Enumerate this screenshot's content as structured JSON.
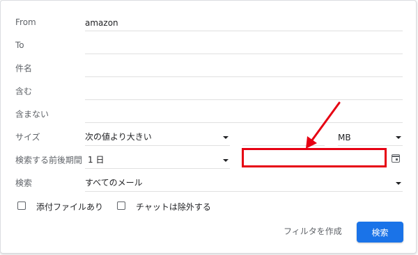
{
  "fields": {
    "from": {
      "label": "From",
      "value": "amazon"
    },
    "to": {
      "label": "To",
      "value": ""
    },
    "subject": {
      "label": "件名",
      "value": ""
    },
    "has_words": {
      "label": "含む",
      "value": ""
    },
    "doesnt_have": {
      "label": "含まない",
      "value": ""
    }
  },
  "size": {
    "label": "サイズ",
    "operator": "次の値より大きい",
    "unit": "MB"
  },
  "date_within": {
    "label": "検索する前後期間",
    "value": "1 日"
  },
  "search_in": {
    "label": "検索",
    "value": "すべてのメール"
  },
  "checkboxes": {
    "has_attachment": "添付ファイルあり",
    "exclude_chats": "チャットは除外する"
  },
  "actions": {
    "create_filter": "フィルタを作成",
    "search": "検索"
  },
  "colors": {
    "accent": "#1a73e8",
    "highlight": "#e60012"
  }
}
